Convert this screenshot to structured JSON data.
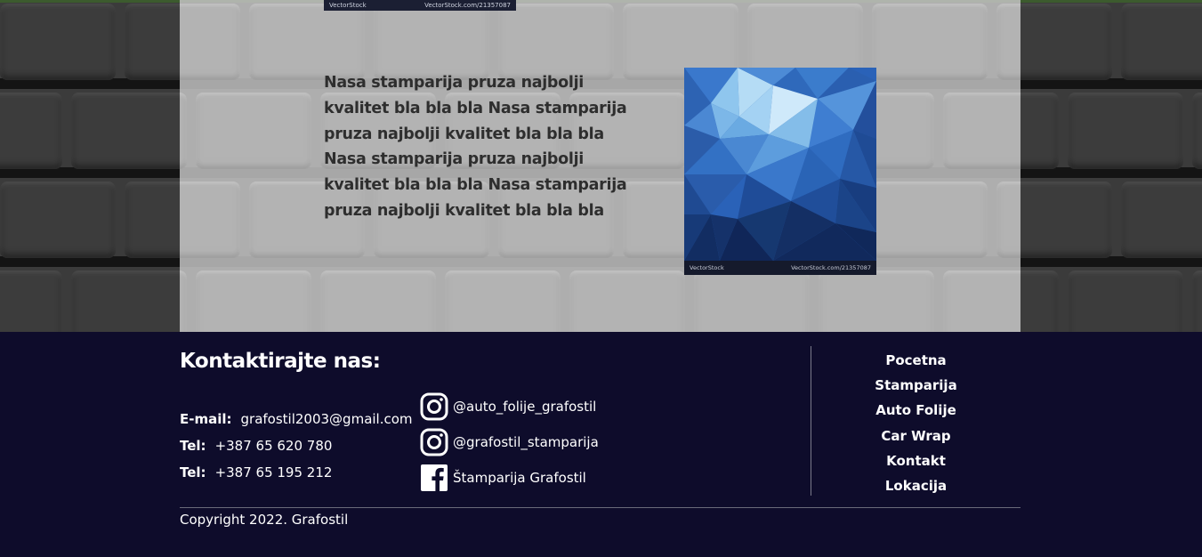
{
  "about": {
    "paragraph": "Nasa stamparija pruza najbolji kvalitet bla bla bla Nasa stamparija pruza najbolji kvalitet bla bla bla Nasa stamparija pruza najbolji kvalitet bla bla bla Nasa stamparija pruza najbolji kvalitet bla bla bla",
    "image_watermark_left": "VectorStock",
    "image_watermark_right": "VectorStock.com/21357087"
  },
  "top_image": {
    "watermark_left": "VectorStock",
    "watermark_right": "VectorStock.com/21357087"
  },
  "footer": {
    "contact_title": "Kontaktirajte nas:",
    "contacts": [
      {
        "label": "E-mail:",
        "value": "grafostil2003@gmail.com"
      },
      {
        "label": "Tel:",
        "value": "+387 65 620 780"
      },
      {
        "label": "Tel:",
        "value": "+387 65 195 212"
      }
    ],
    "socials": [
      {
        "icon": "instagram-icon",
        "text": "@auto_folije_grafostil"
      },
      {
        "icon": "instagram-icon",
        "text": "@grafostil_stamparija"
      },
      {
        "icon": "facebook-icon",
        "text": "Štamparija Grafostil"
      }
    ],
    "nav": [
      "Pocetna",
      "Stamparija",
      "Auto Folije",
      "Car Wrap",
      "Kontakt",
      "Lokacija"
    ],
    "copyright": "Copyright 2022. Grafostil"
  },
  "colors": {
    "footer_bg": "#0e0c2b",
    "panel_overlay": "#c8c8c8",
    "text_dark": "#2e2e2e",
    "accent_line": "#3c5b2e"
  }
}
